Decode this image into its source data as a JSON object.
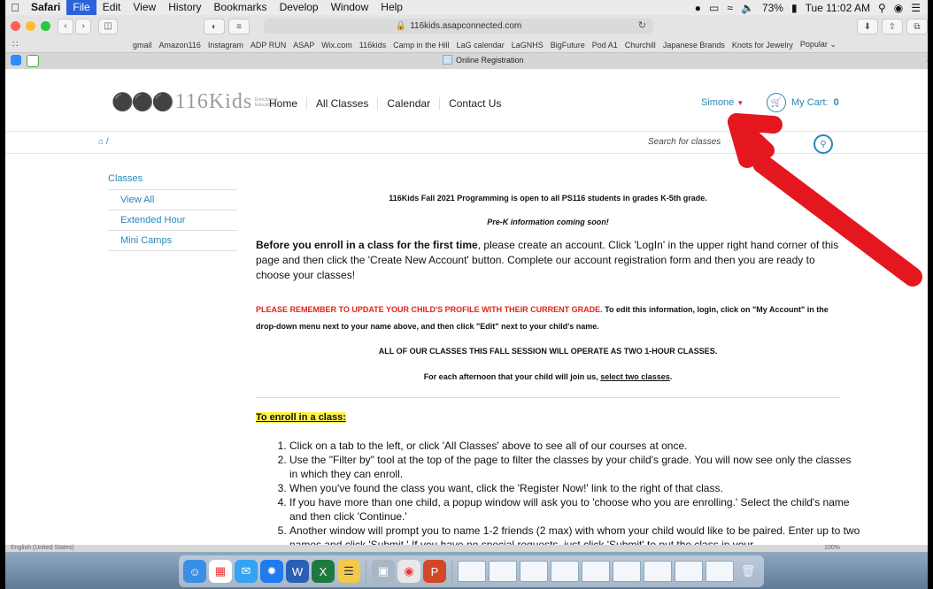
{
  "menubar": {
    "app": "Safari",
    "items": [
      "File",
      "Edit",
      "View",
      "History",
      "Bookmarks",
      "Develop",
      "Window",
      "Help"
    ],
    "battery": "73%",
    "clock": "Tue 11:02 AM"
  },
  "toolbar": {
    "url": "116kids.asapconnected.com"
  },
  "favorites": [
    "gmail",
    "Amazon116",
    "Instagram",
    "ADP RUN",
    "ASAP",
    "Wix.com",
    "116kids",
    "Camp in the Hill",
    "LaG calendar",
    "LaGNHS",
    "BigFuture",
    "Pod A1",
    "Churchill",
    "Japanese Brands",
    "Knots for Jewelry",
    "Popular ⌄"
  ],
  "tab": {
    "title": "Online Registration"
  },
  "header": {
    "logo_text": "116Kids",
    "logo_tag": "Enrichment Education",
    "nav": [
      "Home",
      "All Classes",
      "Calendar",
      "Contact Us"
    ],
    "user": "Simone",
    "cart_label": "My Cart:",
    "cart_count": "0"
  },
  "crumb": {
    "sep": "/"
  },
  "search": {
    "placeholder": "Search for classes"
  },
  "sidebar": {
    "heading": "Classes",
    "items": [
      "View All",
      "Extended Hour",
      "Mini Camps"
    ]
  },
  "content": {
    "announce": "116Kids Fall 2021 Programming is open to all PS116 students in grades K-5th grade.",
    "prek": "Pre-K information coming soon!",
    "intro_bold": "Before you enroll in a class for the first time",
    "intro_rest": ", please create an account. Click 'LogIn' in the upper right hand corner of this page and then click the 'Create New Account' button. Complete our account registration form and then you are ready to choose your classes!",
    "remind_red": "PLEASE REMEMBER TO UPDATE YOUR CHILD'S PROFILE WITH THEIR CURRENT GRADE.",
    "remind_rest": " To edit this information, login, click on \"My Account\" in the drop-down menu next to your name above, and then click \"Edit\" next to your child's name.",
    "session": "ALL OF OUR CLASSES THIS FALL SESSION WILL OPERATE AS TWO 1-HOUR CLASSES.",
    "afternoon_pre": "For each afternoon that your child will join us, ",
    "afternoon_u": "select two classes",
    "afternoon_post": ".",
    "enroll_heading": "To enroll in a class:",
    "steps": [
      "Click on a tab to the left, or click 'All Classes' above to see all of our courses at once.",
      "Use the \"Filter by\" tool at the top of the page to filter the classes by your child's grade. You will now see only the classes in which they can enroll.",
      "When you've found the class you want, click the 'Register Now!' link to the right of that class.",
      "If you have more than one child, a popup window will ask you to 'choose who you are enrolling.' Select the child's name and then click 'Continue.'",
      "Another window will prompt you to name 1-2 friends (2 max) with whom your child would like to be paired. Enter up to two names and click 'Submit.' If you have no special requests, just click 'Submit' to put the class in your"
    ]
  },
  "status": {
    "lang": "English (United States)",
    "zoom": "100%"
  },
  "colors": {
    "accent": "#2a86b6",
    "red": "#e2231a",
    "arrow": "#e5171e",
    "highlight": "#fff34a"
  }
}
